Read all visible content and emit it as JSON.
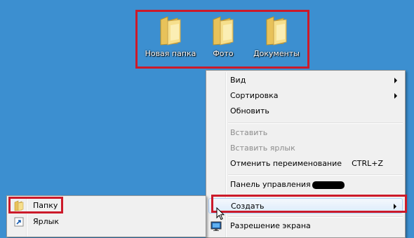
{
  "desktop": {
    "background_color": "#3c8fd0",
    "icons": [
      {
        "label": "Новая папка",
        "icon": "folder-icon"
      },
      {
        "label": "Фото",
        "icon": "folder-icon"
      },
      {
        "label": "Документы",
        "icon": "folder-icon"
      }
    ]
  },
  "context_menu": {
    "items": [
      {
        "label": "Вид",
        "has_submenu": true,
        "enabled": true
      },
      {
        "label": "Сортировка",
        "has_submenu": true,
        "enabled": true
      },
      {
        "label": "Обновить",
        "enabled": true
      },
      {
        "label": "Вставить",
        "enabled": false
      },
      {
        "label": "Вставить ярлык",
        "enabled": false
      },
      {
        "label": "Отменить переименование",
        "shortcut": "CTRL+Z",
        "enabled": true
      },
      {
        "label": "Панель управления",
        "enabled": true
      },
      {
        "label": "Создать",
        "has_submenu": true,
        "enabled": true,
        "highlighted": true
      },
      {
        "label": "Разрешение экрана",
        "icon": "display-icon",
        "enabled": true
      }
    ]
  },
  "create_submenu": {
    "items": [
      {
        "label": "Папку",
        "icon": "folder-icon"
      },
      {
        "label": "Ярлык",
        "icon": "shortcut-icon"
      }
    ]
  },
  "highlight_color": "#cc1a2a"
}
